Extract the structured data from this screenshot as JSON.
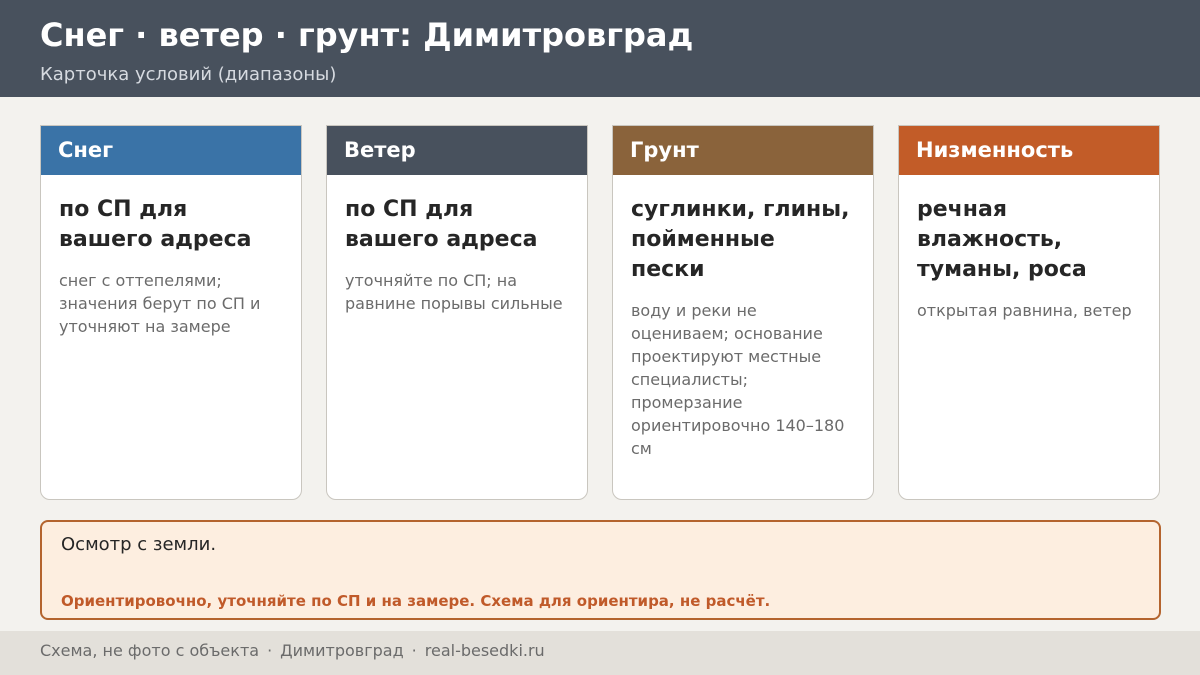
{
  "header": {
    "title": "Снег · ветер · грунт: Димитровград",
    "subtitle": "Карточка условий (диапазоны)"
  },
  "colors": {
    "header_bg": "#48515d",
    "snow": "#3a73a7",
    "wind": "#48515d",
    "ground": "#8a633b",
    "lowland": "#c25c28",
    "note_bg": "#fdeee0",
    "note_border": "#b4642e",
    "warning_text": "#c05a2a"
  },
  "cards": [
    {
      "title": "Снег",
      "main": "по СП для вашего адреса",
      "note": "снег с оттепелями; значения берут по СП и уточняют на замере"
    },
    {
      "title": "Ветер",
      "main": "по СП для вашего адреса",
      "note": "уточняйте по СП; на равнине порывы сильные"
    },
    {
      "title": "Грунт",
      "main": "суглинки, глины, пойменные пески",
      "note": "воду и реки не оцениваем; основание проектируют местные специалисты; промерзание ориентировочно 140–180 см"
    },
    {
      "title": "Низменность",
      "main": "речная влажность, туманы, роса",
      "note": "открытая равнина, ветер"
    }
  ],
  "note_box": {
    "text": "Осмотр с земли.",
    "warning": "Ориентировочно, уточняйте по СП и на замере. Схема для ориентира, не расчёт."
  },
  "footer": {
    "left": "Схема, не фото с объекта",
    "separator": "·",
    "city": "Димитровград",
    "site": "real-besedki.ru"
  }
}
